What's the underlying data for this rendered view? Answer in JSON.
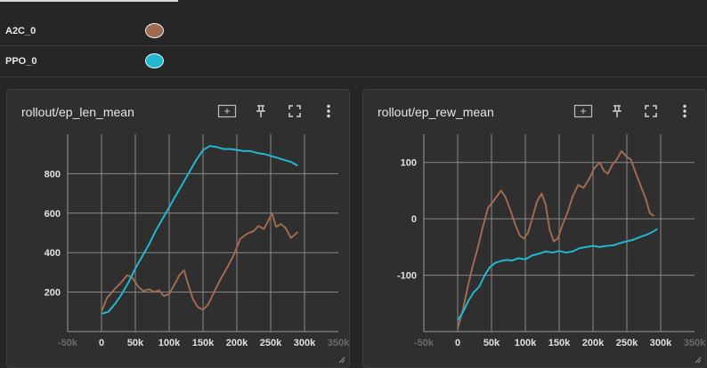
{
  "runs": [
    {
      "name": "A2C_0",
      "color": "#9e6a52"
    },
    {
      "name": "PPO_0",
      "color": "#20b8cf"
    }
  ],
  "cards": [
    {
      "title": "rollout/ep_len_mean",
      "tools": [
        "fit-domain-icon",
        "pin-icon",
        "fullscreen-icon",
        "more-vert-icon"
      ]
    },
    {
      "title": "rollout/ep_rew_mean",
      "tools": [
        "fit-domain-icon",
        "pin-icon",
        "fullscreen-icon",
        "more-vert-icon"
      ]
    }
  ],
  "chart_data": [
    {
      "type": "line",
      "title": "rollout/ep_len_mean",
      "xlabel": "",
      "ylabel": "",
      "xlim": [
        -50000,
        350000
      ],
      "ylim": [
        0,
        1000
      ],
      "x_ticks": [
        "-50k",
        "0",
        "50k",
        "100k",
        "150k",
        "200k",
        "250k",
        "300k",
        "350k"
      ],
      "y_ticks": [
        "200",
        "400",
        "600",
        "800"
      ],
      "y_tick_values": [
        200,
        400,
        600,
        800
      ],
      "grid": true,
      "series": [
        {
          "name": "A2C_0",
          "color": "#9e6a52",
          "x": [
            0,
            8000,
            18000,
            28000,
            38000,
            45000,
            55000,
            62000,
            70000,
            78000,
            85000,
            92000,
            100000,
            108000,
            115000,
            122000,
            128000,
            135000,
            142000,
            150000,
            158000,
            165000,
            175000,
            185000,
            195000,
            205000,
            215000,
            225000,
            232000,
            240000,
            247000,
            252000,
            258000,
            265000,
            272000,
            280000,
            287000,
            290000
          ],
          "y": [
            100,
            170,
            210,
            245,
            285,
            275,
            225,
            205,
            215,
            200,
            210,
            180,
            190,
            240,
            285,
            310,
            240,
            165,
            125,
            110,
            140,
            190,
            260,
            320,
            385,
            470,
            495,
            510,
            535,
            520,
            565,
            600,
            530,
            545,
            525,
            475,
            495,
            505
          ]
        },
        {
          "name": "PPO_0",
          "color": "#20b8cf",
          "x": [
            0,
            10000,
            20000,
            30000,
            40000,
            50000,
            60000,
            70000,
            80000,
            90000,
            100000,
            110000,
            120000,
            130000,
            140000,
            150000,
            160000,
            170000,
            180000,
            190000,
            200000,
            210000,
            220000,
            230000,
            240000,
            250000,
            260000,
            270000,
            280000,
            290000
          ],
          "y": [
            90,
            100,
            140,
            190,
            250,
            320,
            380,
            440,
            510,
            570,
            630,
            690,
            750,
            810,
            870,
            920,
            940,
            935,
            925,
            925,
            920,
            915,
            915,
            905,
            900,
            890,
            880,
            870,
            860,
            840
          ]
        }
      ]
    },
    {
      "type": "line",
      "title": "rollout/ep_rew_mean",
      "xlabel": "",
      "ylabel": "",
      "xlim": [
        -50000,
        350000
      ],
      "ylim": [
        -200,
        150
      ],
      "x_ticks": [
        "-50k",
        "0",
        "50k",
        "100k",
        "150k",
        "200k",
        "250k",
        "300k",
        "350k"
      ],
      "y_ticks": [
        "-100",
        "0",
        "100"
      ],
      "y_tick_values": [
        -100,
        0,
        100
      ],
      "grid": true,
      "series": [
        {
          "name": "A2C_0",
          "color": "#9e6a52",
          "x": [
            0,
            8000,
            15000,
            22000,
            30000,
            38000,
            45000,
            52000,
            58000,
            64000,
            70000,
            78000,
            85000,
            92000,
            98000,
            104000,
            110000,
            117000,
            124000,
            130000,
            136000,
            142000,
            148000,
            155000,
            162000,
            170000,
            178000,
            186000,
            194000,
            202000,
            210000,
            216000,
            222000,
            228000,
            235000,
            242000,
            250000,
            256000,
            262000,
            270000,
            278000,
            284000,
            290000
          ],
          "y": [
            -195,
            -160,
            -120,
            -85,
            -50,
            -10,
            20,
            30,
            40,
            50,
            40,
            15,
            -10,
            -30,
            -35,
            -25,
            0,
            30,
            45,
            25,
            -20,
            -40,
            -35,
            -10,
            10,
            40,
            60,
            55,
            70,
            90,
            100,
            85,
            80,
            95,
            105,
            120,
            110,
            105,
            85,
            60,
            35,
            10,
            5
          ]
        },
        {
          "name": "PPO_0",
          "color": "#20b8cf",
          "x": [
            0,
            8000,
            16000,
            24000,
            32000,
            40000,
            48000,
            56000,
            64000,
            72000,
            80000,
            90000,
            100000,
            110000,
            120000,
            130000,
            140000,
            150000,
            160000,
            170000,
            180000,
            190000,
            200000,
            210000,
            220000,
            230000,
            240000,
            250000,
            260000,
            270000,
            280000,
            290000,
            295000
          ],
          "y": [
            -180,
            -165,
            -145,
            -130,
            -120,
            -100,
            -85,
            -78,
            -75,
            -73,
            -74,
            -70,
            -72,
            -65,
            -62,
            -58,
            -60,
            -57,
            -60,
            -58,
            -52,
            -50,
            -48,
            -50,
            -48,
            -47,
            -43,
            -40,
            -37,
            -32,
            -28,
            -22,
            -18
          ]
        }
      ]
    }
  ]
}
